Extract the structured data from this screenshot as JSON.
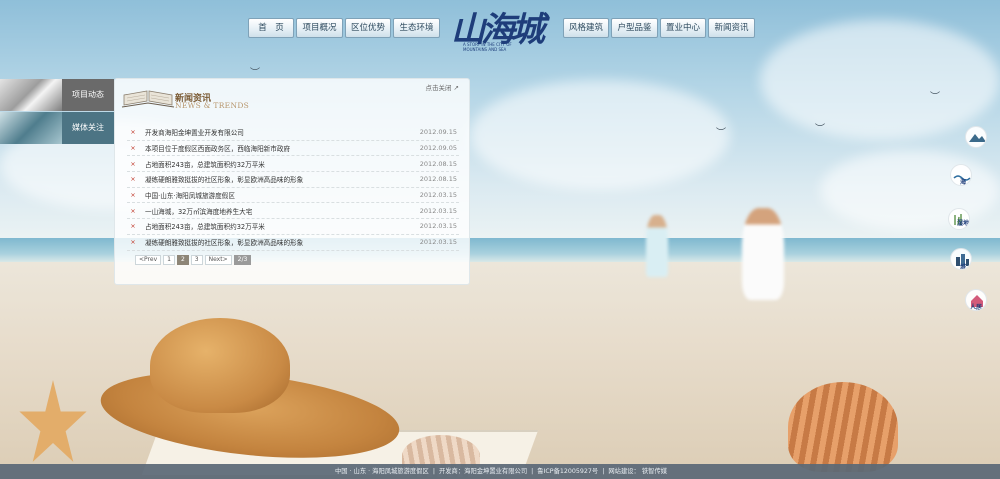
{
  "nav": {
    "left": [
      "首　页",
      "项目概况",
      "区位优势",
      "生态环境"
    ],
    "right": [
      "风格建筑",
      "户型品鉴",
      "置业中心",
      "新闻资讯"
    ]
  },
  "logo": {
    "text": "山海城",
    "sub": "A STORY IN THE CITY OF MOUNTAINS AND SEA"
  },
  "side_tabs": [
    {
      "label": "项目动态"
    },
    {
      "label": "媒体关注"
    }
  ],
  "panel": {
    "close": "点击关闭",
    "title": "新闻资讯",
    "subtitle": "NEWS & TRENDS"
  },
  "news": [
    {
      "title": "开发商海阳金坤置业开发有限公司",
      "date": "2012.09.15"
    },
    {
      "title": "本项目位于度假区西面政务区，西临海阳新市政府",
      "date": "2012.09.05"
    },
    {
      "title": "占地面积243亩，总建筑面积约32万平米",
      "date": "2012.08.15"
    },
    {
      "title": "凝练硬朗雅致挺拔的社区形象，彰显欧洲高品味的形象",
      "date": "2012.08.15"
    },
    {
      "title": "中国·山东·海阳凤城旅游度假区",
      "date": "2012.03.15"
    },
    {
      "title": "一山海城，32万㎡滨海度地养生大宅",
      "date": "2012.03.15"
    },
    {
      "title": "占地面积243亩，总建筑面积约32万平米",
      "date": "2012.03.15"
    },
    {
      "title": "凝练硬朗雅致挺拔的社区形象，彰显欧洲高品味的形象",
      "date": "2012.03.15"
    }
  ],
  "pager": {
    "prev": "<Prev",
    "pages": [
      "1",
      "2",
      "3"
    ],
    "current": "2",
    "next": "Next>",
    "info": "2/3"
  },
  "right_icons": [
    {
      "label": "",
      "icon": "mountain-icon"
    },
    {
      "label": "海",
      "icon": "sea-icon"
    },
    {
      "label": "湿地",
      "icon": "wetland-icon"
    },
    {
      "label": "城",
      "icon": "city-icon"
    },
    {
      "label": "人居",
      "icon": "residence-icon"
    }
  ],
  "footer": {
    "address": "中国 · 山东 · 海阳凤城旅游度假区",
    "developer": "开发商：海阳金坤置业有限公司",
    "icp": "鲁ICP备12005927号",
    "credit_label": "网站建设：",
    "credit_link": "铁智传媒"
  }
}
